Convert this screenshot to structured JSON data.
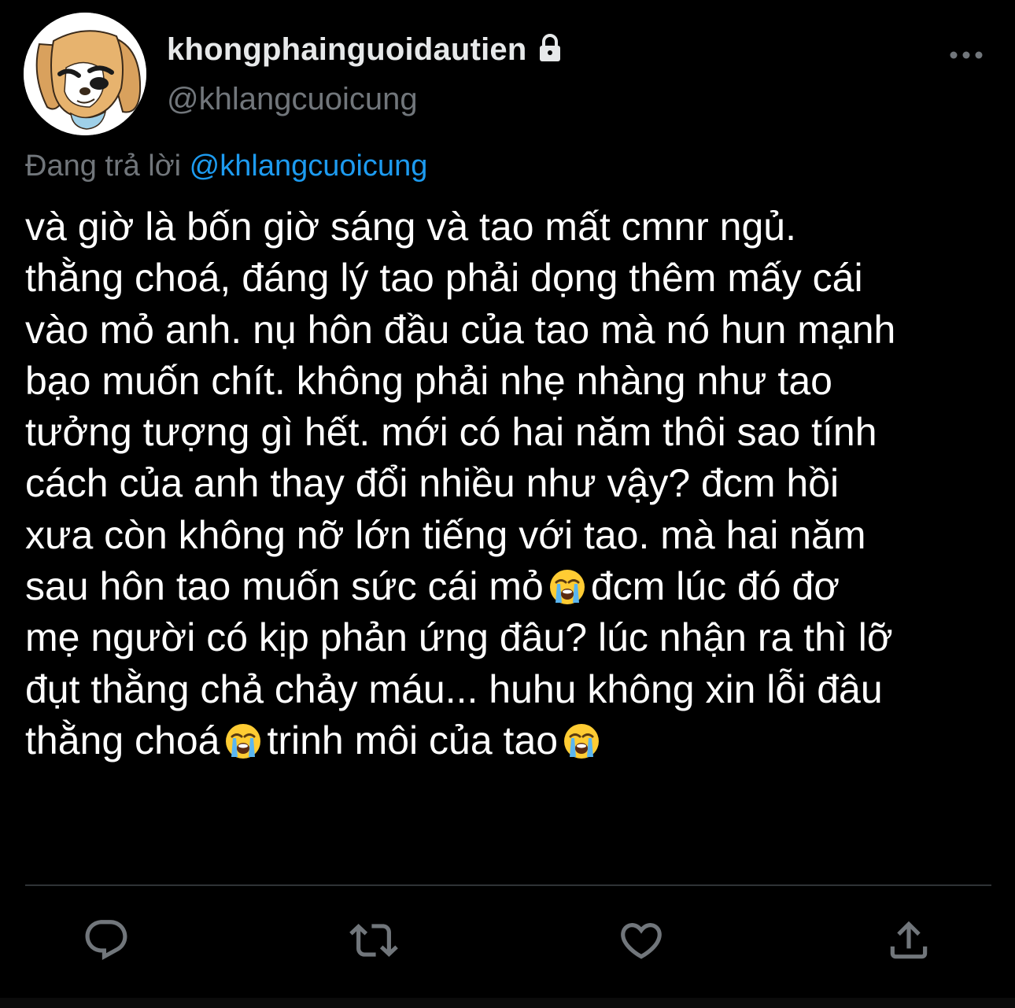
{
  "tweet": {
    "display_name": "khongphainguoidautien",
    "handle": "@khlangcuoicung",
    "replying_prefix": "Đang trả lời",
    "replying_to": "@khlangcuoicung",
    "lines": [
      "và giờ là bốn giờ sáng và tao mất cmnr ngủ.",
      "thằng choá, đáng lý tao phải dọng thêm mấy cái",
      "vào mỏ anh. nụ hôn đầu của tao mà nó hun mạnh",
      "bạo muốn chít. không phải nhẹ nhàng như tao",
      "tưởng tượng gì hết. mới có hai năm thôi sao tính",
      "cách của anh thay đổi nhiều như vậy? đcm hồi",
      "xưa còn không nỡ lớn tiếng với tao. mà hai năm",
      "sau hôn tao muốn sức cái mỏ",
      "đcm lúc đó đơ",
      "mẹ người có kịp phản ứng đâu? lúc nhận ra thì lỡ",
      "đụt thằng chả chảy máu... huhu không xin lỗi đâu",
      "thằng choá",
      "trinh môi của tao"
    ]
  },
  "icons": {
    "lock": "lock-icon",
    "more": "more-horizontal-icon",
    "emoji": "loudly-crying-face-emoji",
    "reply": "reply-icon",
    "retweet": "retweet-icon",
    "like": "heart-icon",
    "share": "share-icon"
  },
  "colors": {
    "background": "#000000",
    "text": "#ffffff",
    "secondary_text": "#71767b",
    "link": "#1d9bf0",
    "divider": "#2f3336"
  }
}
